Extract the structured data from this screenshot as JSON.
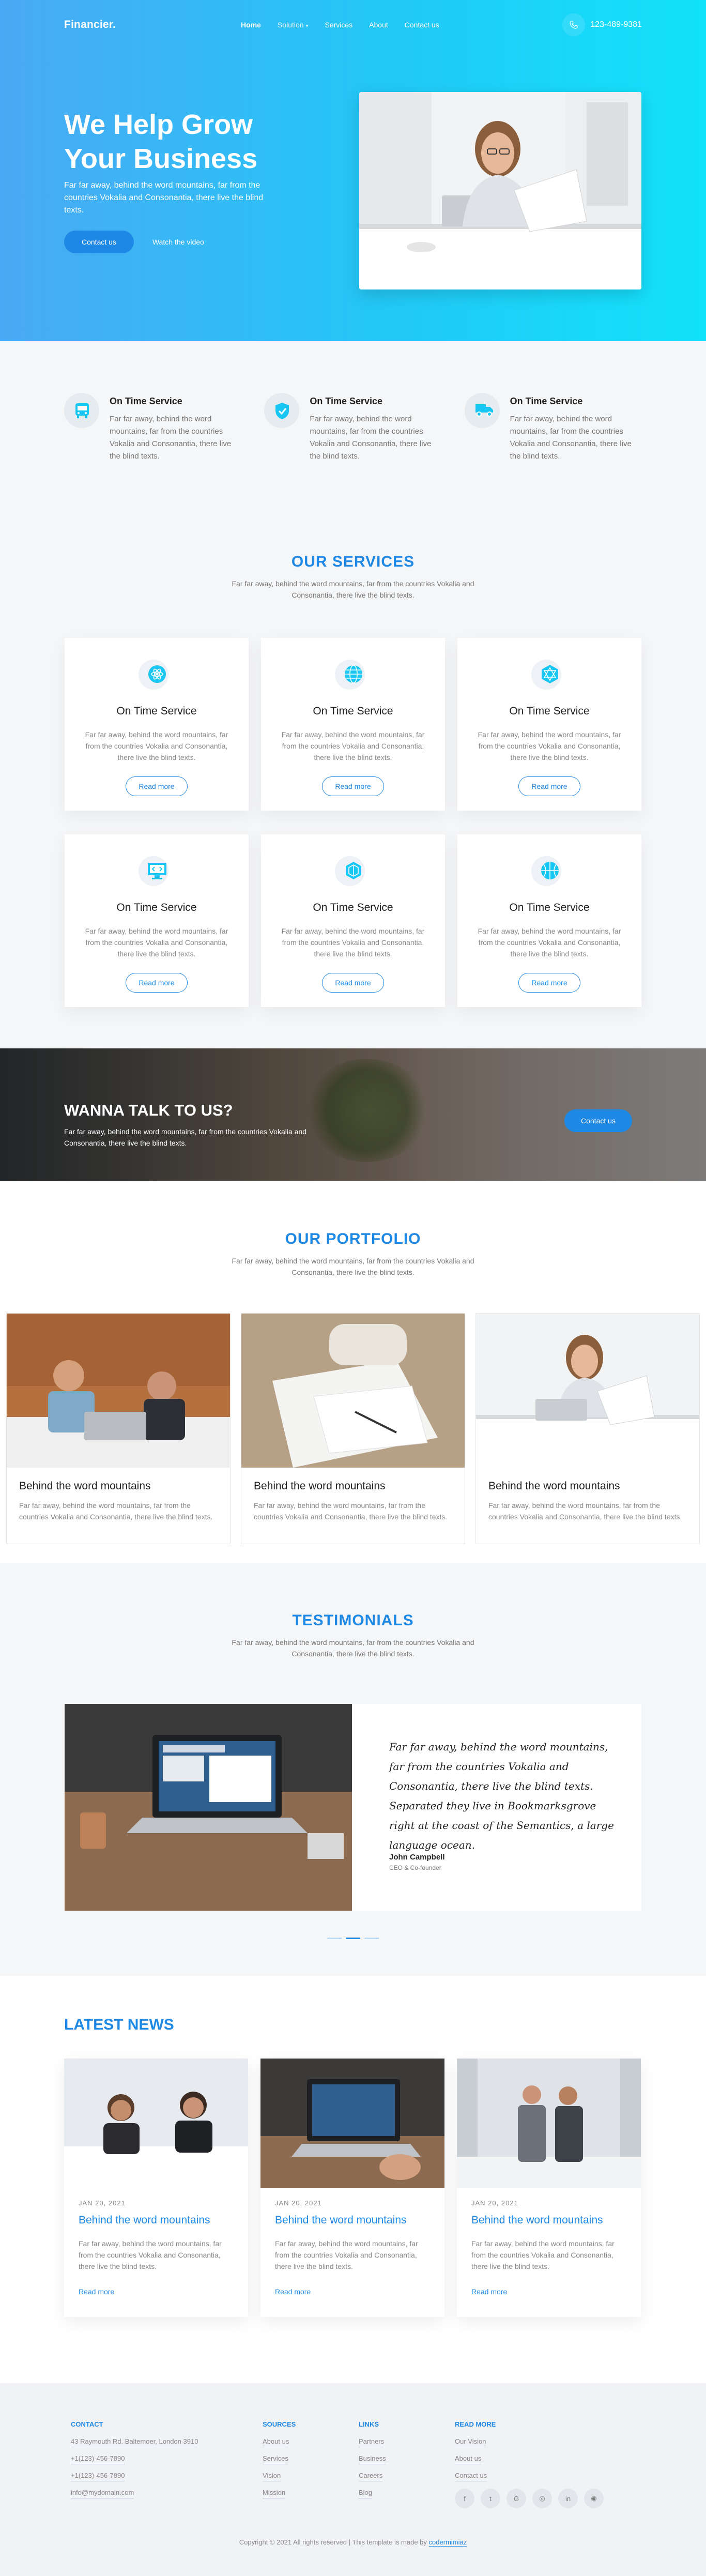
{
  "nav": {
    "brand": "Financier.",
    "links": [
      "Home",
      "Solution",
      "Services",
      "About",
      "Contact us"
    ],
    "phone": "123-489-9381"
  },
  "hero": {
    "title": "We Help Grow Your Business",
    "text": "Far far away, behind the word mountains, far from the countries Vokalia and Consonantia, there live the blind texts.",
    "primary_button": "Contact us",
    "secondary_link": "Watch the video"
  },
  "features": [
    {
      "title": "On Time Service",
      "text": "Far far away, behind the word mountains, far from the countries Vokalia and Consonantia, there live the blind texts.",
      "icon": "bus-icon"
    },
    {
      "title": "On Time Service",
      "text": "Far far away, behind the word mountains, far from the countries Vokalia and Consonantia, there live the blind texts.",
      "icon": "shield-icon"
    },
    {
      "title": "On Time Service",
      "text": "Far far away, behind the word mountains, far from the countries Vokalia and Consonantia, there live the blind texts.",
      "icon": "truck-icon"
    }
  ],
  "services": {
    "title": "OUR SERVICES",
    "subtitle": "Far far away, behind the word mountains, far from the countries Vokalia and Consonantia, there live the blind texts.",
    "cards": [
      {
        "title": "On Time Service",
        "text": "Far far away, behind the word mountains, far from the countries Vokalia and Consonantia, there live the blind texts.",
        "button": "Read more",
        "icon": "atom-icon"
      },
      {
        "title": "On Time Service",
        "text": "Far far away, behind the word mountains, far from the countries Vokalia and Consonantia, there live the blind texts.",
        "button": "Read more",
        "icon": "globe-icon"
      },
      {
        "title": "On Time Service",
        "text": "Far far away, behind the word mountains, far from the countries Vokalia and Consonantia, there live the blind texts.",
        "button": "Read more",
        "icon": "polyhedron-icon"
      },
      {
        "title": "On Time Service",
        "text": "Far far away, behind the word mountains, far from the countries Vokalia and Consonantia, there live the blind texts.",
        "button": "Read more",
        "icon": "monitor-code-icon"
      },
      {
        "title": "On Time Service",
        "text": "Far far away, behind the word mountains, far from the countries Vokalia and Consonantia, there live the blind texts.",
        "button": "Read more",
        "icon": "hexagon-icon"
      },
      {
        "title": "On Time Service",
        "text": "Far far away, behind the word mountains, far from the countries Vokalia and Consonantia, there live the blind texts.",
        "button": "Read more",
        "icon": "basketball-icon"
      }
    ]
  },
  "cta": {
    "title": "WANNA TALK TO US?",
    "text": "Far far away, behind the word mountains, far from the countries Vokalia and Consonantia, there live the blind texts.",
    "button": "Contact us"
  },
  "portfolio": {
    "title": "OUR PORTFOLIO",
    "subtitle": "Far far away, behind the word mountains, far from the countries Vokalia and Consonantia, there live the blind texts.",
    "items": [
      {
        "title": "Behind the word mountains",
        "text": "Far far away, behind the word mountains, far from the countries Vokalia and Consonantia, there live the blind texts."
      },
      {
        "title": "Behind the word mountains",
        "text": "Far far away, behind the word mountains, far from the countries Vokalia and Consonantia, there live the blind texts."
      },
      {
        "title": "Behind the word mountains",
        "text": "Far far away, behind the word mountains, far from the countries Vokalia and Consonantia, there live the blind texts."
      }
    ]
  },
  "testimonials": {
    "title": "TESTIMONIALS",
    "subtitle": "Far far away, behind the word mountains, far from the countries Vokalia and Consonantia, there live the blind texts.",
    "quote": "Far far away, behind the word mountains, far from the countries Vokalia and Consonantia, there live the blind texts. Separated they live in Bookmarksgrove right at the coast of the Semantics, a large language ocean.",
    "name": "John Campbell",
    "role": "CEO & Co-founder"
  },
  "news": {
    "title": "LATEST NEWS",
    "items": [
      {
        "date": "JAN 20, 2021",
        "title": "Behind the word mountains",
        "text": "Far far away, behind the word mountains, far from the countries Vokalia and Consonantia, there live the blind texts.",
        "link": "Read more"
      },
      {
        "date": "JAN 20, 2021",
        "title": "Behind the word mountains",
        "text": "Far far away, behind the word mountains, far from the countries Vokalia and Consonantia, there live the blind texts.",
        "link": "Read more"
      },
      {
        "date": "JAN 20, 2021",
        "title": "Behind the word mountains",
        "text": "Far far away, behind the word mountains, far from the countries Vokalia and Consonantia, there live the blind texts.",
        "link": "Read more"
      }
    ]
  },
  "footer": {
    "contact": {
      "title": "CONTACT",
      "address": "43 Raymouth Rd. Baltemoer, London 3910",
      "phone1": "+1(123)-456-7890",
      "phone2": "+1(123)-456-7890",
      "email": "info@mydomain.com"
    },
    "sources": {
      "title": "SOURCES",
      "items": [
        "About us",
        "Services",
        "Vision",
        "Mission"
      ]
    },
    "links": {
      "title": "LINKS",
      "items": [
        "Partners",
        "Business",
        "Careers",
        "Blog"
      ]
    },
    "readmore": {
      "title": "READ MORE",
      "items": [
        "Our Vision",
        "About us",
        "Contact us"
      ]
    },
    "socials": [
      "f",
      "t",
      "G",
      "◎",
      "in",
      "◉"
    ],
    "copyright_pre": "Copyright © 2021 All rights reserved | This template is made by",
    "copyright_maker": "codermimiaz"
  },
  "colors": {
    "accent": "#1e88e5",
    "hero_start": "#4aa9f4",
    "hero_end": "#12e2fb"
  }
}
